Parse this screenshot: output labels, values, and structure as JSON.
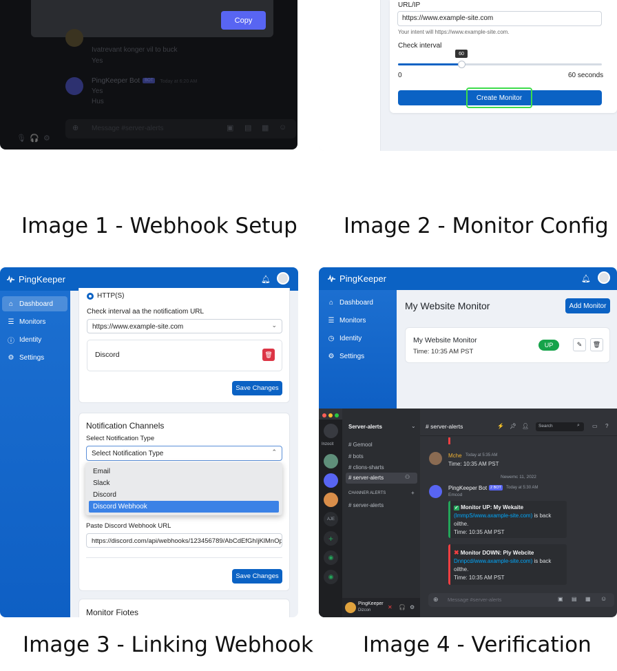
{
  "captions": {
    "image1": "Image 1 - Webhook Setup",
    "image2": "Image 2 - Monitor Config",
    "image3": "Image 3 - Linking Webhook",
    "image4": "Image 4 - Verification"
  },
  "webhook_setup": {
    "copy_button": "Copy",
    "faint_lines": [
      "Ivatrevant konger vil to buck",
      "Yes"
    ],
    "bot_name": "PingKeeper Bot",
    "bot_badge": "BOT",
    "bot_time": "Today at 6:20 AM",
    "bot_lines": [
      "Yes",
      "Hus"
    ],
    "message_placeholder": "Message #server-alerts"
  },
  "monitor_config": {
    "url_label": "URL/IP",
    "url_value": "https://www.example-site.com",
    "url_help": "Your intent will https://www.example-site.com.",
    "interval_label": "Check interval",
    "slider_value": 60,
    "slider_max": 60,
    "slider_level": 0.31,
    "slider_min_label": "0",
    "slider_max_label": "60 seconds",
    "create_button": "Create Monitor"
  },
  "linking_webhook": {
    "brand": "PingKeeper",
    "nav": [
      "Dashboard",
      "Monitors",
      "Identity",
      "Settings"
    ],
    "protocol_option": "HTTP(S)",
    "url_field_label": "Check interval aa the notificatiom URL",
    "url_field_value": "https://www.example-site.com",
    "channel_name": "Discord",
    "save_button_1": "Save Changes",
    "notif_title": "Notification Channels",
    "select_label": "Select Notification Type",
    "select_value": "Select Notification Type",
    "options": [
      "Email",
      "Slack",
      "Discord",
      "Discord Webhook"
    ],
    "selected_option": "Discord Webhook",
    "webhook_label": "Paste Discord Webhook URL",
    "webhook_value": "https://discord.com/api/webhooks/123456789/AbCdEfGhIjKlMnOp",
    "save_button_2": "Save Changes",
    "notes_title": "Monitor Fiotes"
  },
  "verification": {
    "brand": "PingKeeper",
    "nav": [
      "Dashboard",
      "Monitors",
      "Identity",
      "Settings"
    ],
    "page_title": "My Website Monitor",
    "add_button": "Add Monitor",
    "monitor_name": "My Website Monitor",
    "monitor_time": "Time: 10:35 AM PST",
    "status_badge": "UP",
    "status_color": "#16a34a",
    "discord": {
      "server_name": "Server-alerts",
      "rail_label": "Inzocit",
      "channels": [
        "Gemool",
        "bots",
        "clions-sharts",
        "server-alerts"
      ],
      "category": "CHANNER ALERTS",
      "category_channel": "server-alerts",
      "header_channel": "server-alerts",
      "search_placeholder": "Search",
      "msg1_author": "Mche",
      "msg1_time": "Today at 5:35 AM",
      "msg1_text": "Time: 10:35 AM PST",
      "date_divider": "Newemc 11, 2022",
      "bot_author": "PingKeeper Bot",
      "bot_badge": "2 BOT",
      "bot_time": "Today at 5:30 AM",
      "bot_sub": "Emcod",
      "embed1_title": "Monitor UP: My Wekaite",
      "embed1_link": "(lmmpS/www.axample-site.com)",
      "embed1_rest": " is back",
      "embed1_line3": "oilthe.",
      "embed1_time": "Time: 10:35 AM PST",
      "embed2_title": "Monitor DOWN: Ply Webcite",
      "embed2_link": "Dnnpcd/www.axample-site.com)",
      "embed2_rest": " is back",
      "embed2_line3": "oilthe.",
      "embed2_time": "Time: 10:35 AM PST",
      "user_name": "PingKeeper",
      "user_status": "Dizcon",
      "message_placeholder": "Message #server-alerts",
      "rail_badge": "AJE"
    }
  }
}
